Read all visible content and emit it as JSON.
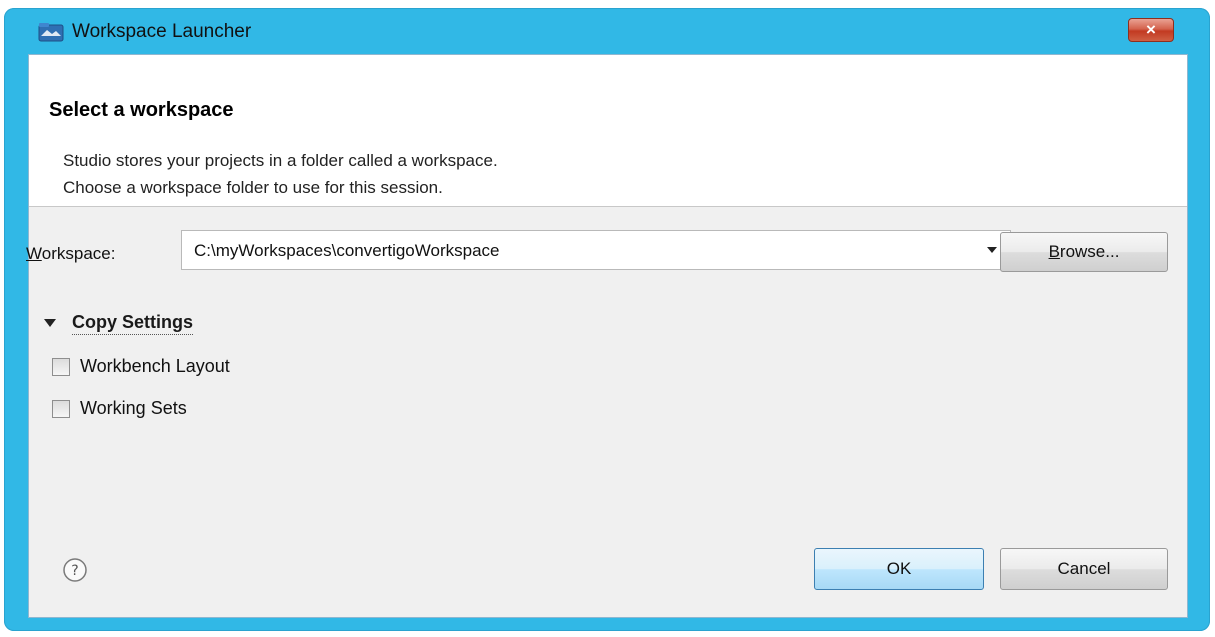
{
  "window": {
    "title": "Workspace Launcher",
    "close_label": "×",
    "icon": "eclipse-folder-icon"
  },
  "header": {
    "title": "Select a workspace",
    "description_line1": "Studio stores your projects in a folder called a workspace.",
    "description_line2": "Choose a workspace folder to use for this session."
  },
  "workspace": {
    "label_mnemonic": "W",
    "label_rest": "orkspace:",
    "value": "C:\\myWorkspaces\\convertigoWorkspace"
  },
  "buttons": {
    "browse_mnemonic": "B",
    "browse_rest": "rowse...",
    "ok": "OK",
    "cancel": "Cancel"
  },
  "copy_settings": {
    "label": "Copy Settings",
    "expanded": true,
    "options": [
      {
        "label": "Workbench Layout",
        "checked": false
      },
      {
        "label": "Working Sets",
        "checked": false
      }
    ]
  },
  "colors": {
    "frame": "#31b8e6",
    "close_button": "#c23a22",
    "dialog_bg": "#f0f0f0",
    "header_bg": "#ffffff"
  },
  "icons": {
    "help": "help-question-icon",
    "dropdown": "chevron-down-icon",
    "expander": "triangle-down-icon"
  }
}
